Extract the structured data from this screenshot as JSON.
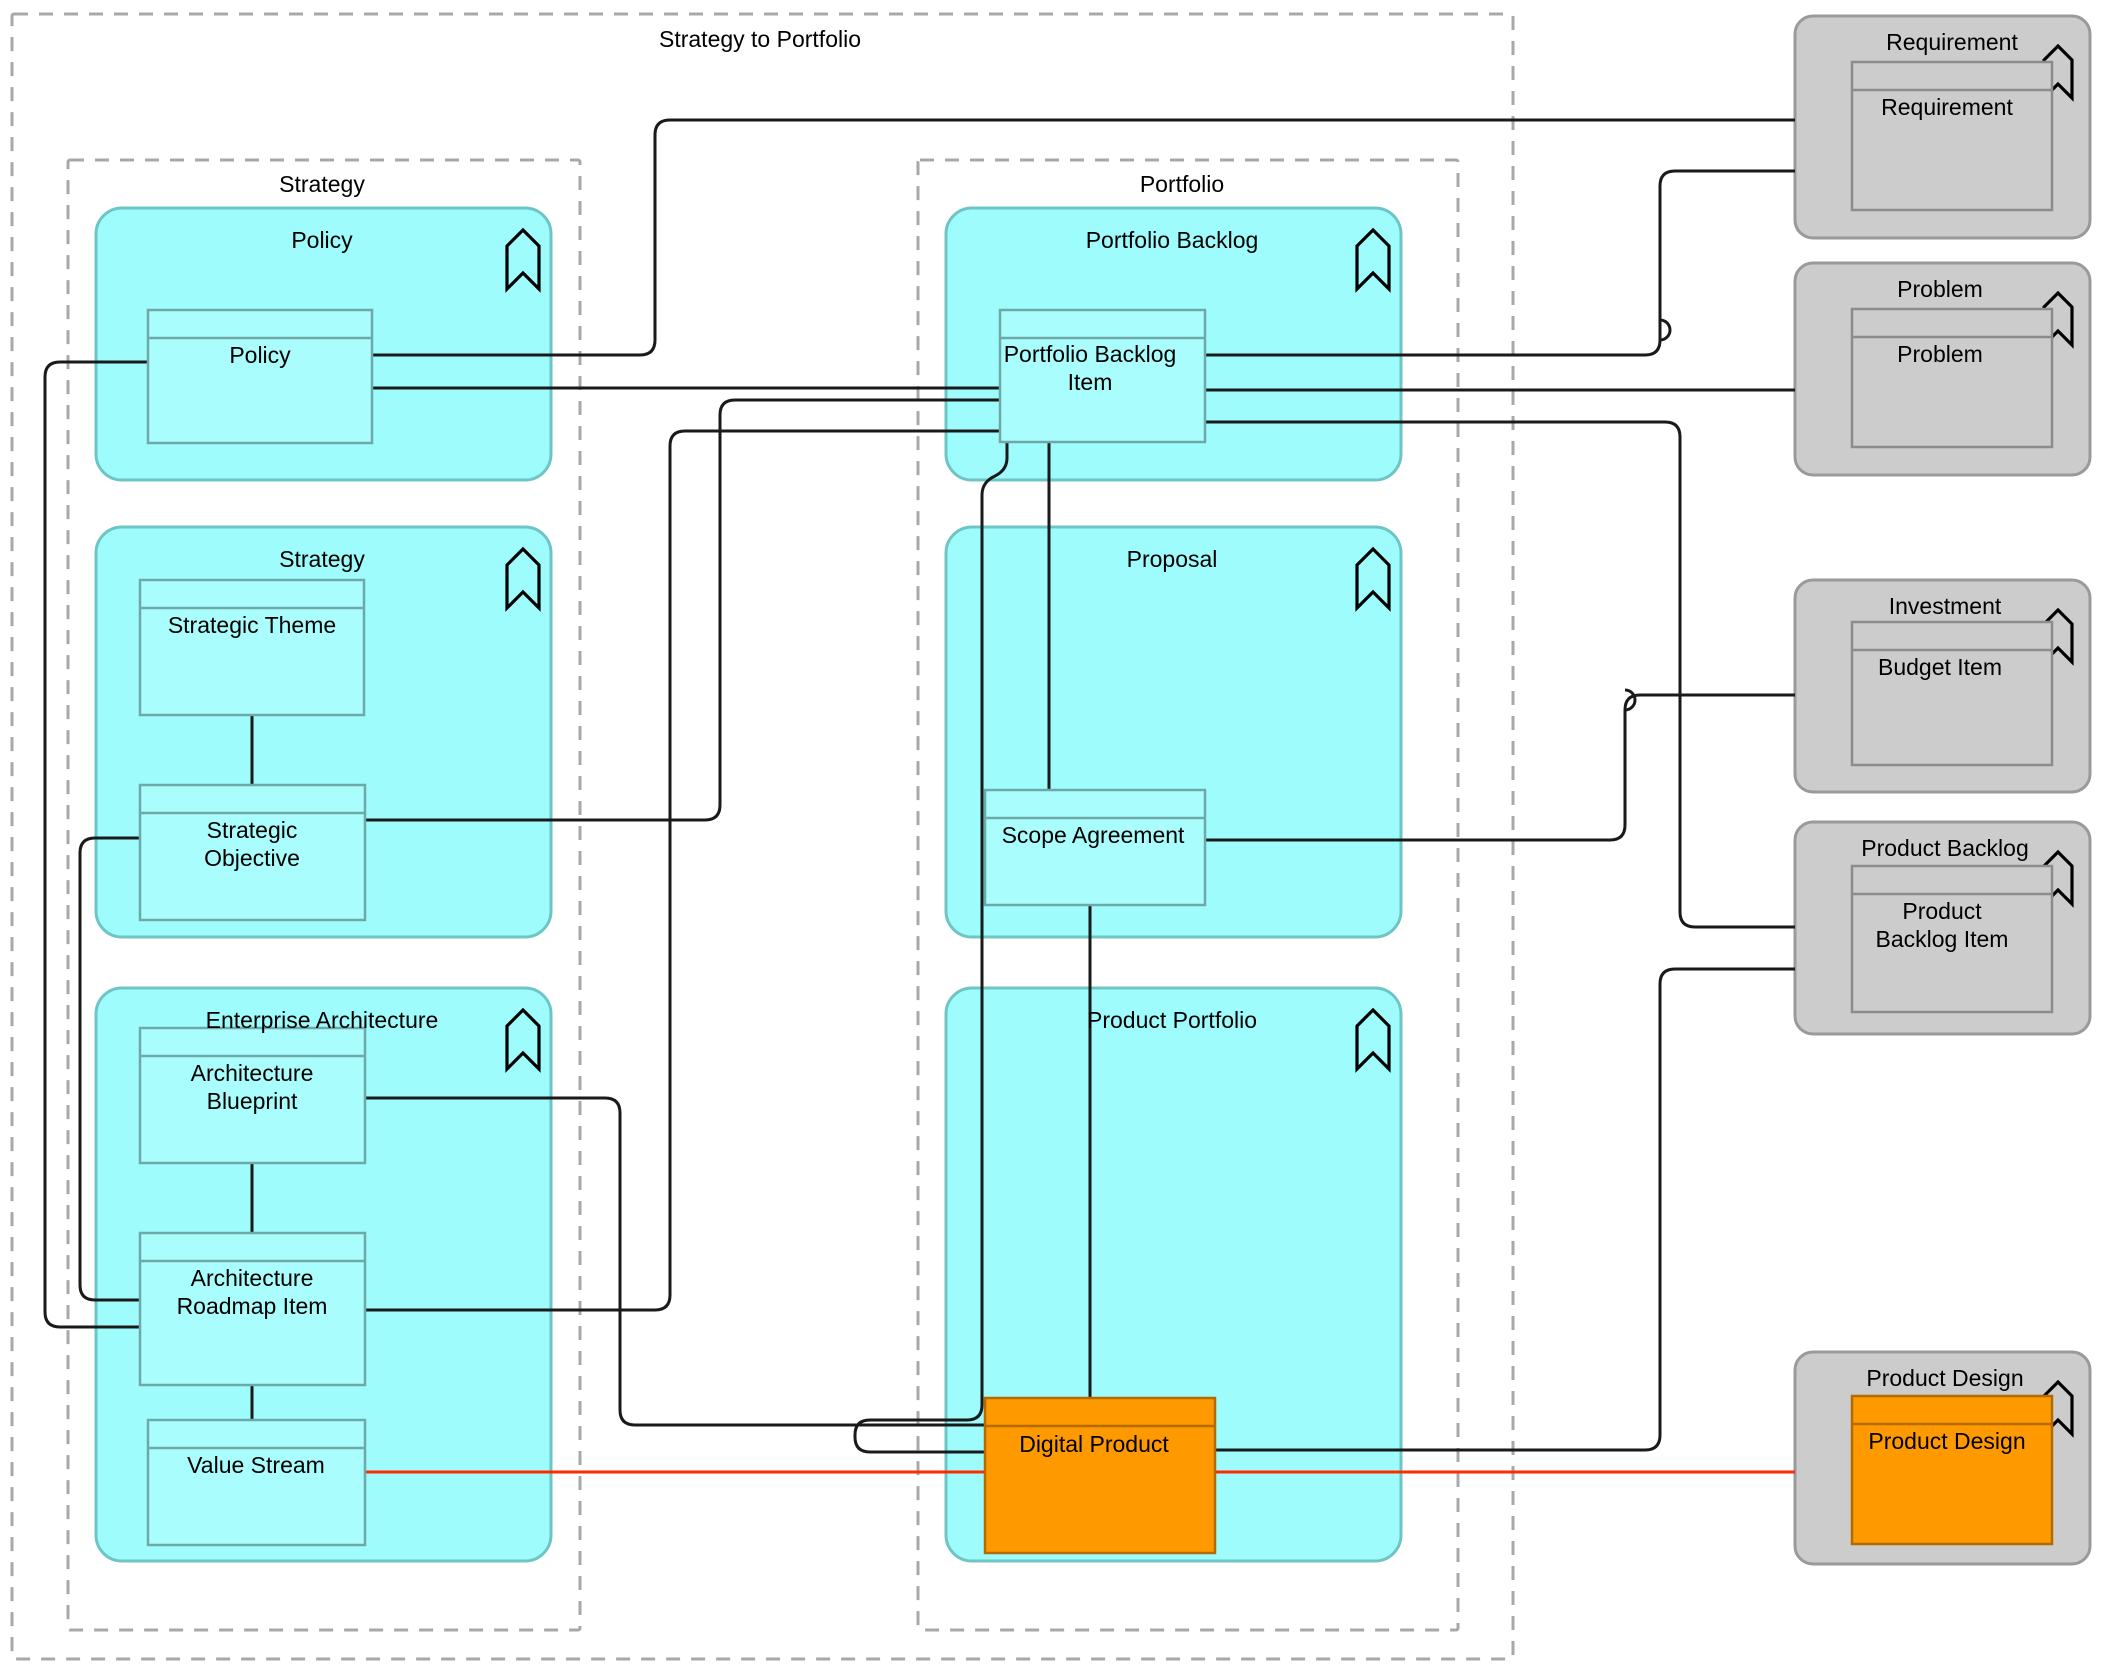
{
  "diagram": {
    "title": "Strategy to Portfolio",
    "colors": {
      "group_cyan_fill": "#9ffcfc",
      "group_cyan_stroke": "#6fc4c4",
      "inner_cyan_fill": "#aafdfd",
      "inner_cyan_stroke": "#6fa8a8",
      "group_gray_fill": "#cccccc",
      "group_gray_stroke": "#9a9a9a",
      "inner_gray_fill": "#cccccc",
      "inner_gray_stroke": "#8c8c8c",
      "orange_fill": "#ff9900",
      "orange_stroke": "#b36b00",
      "connector_black": "#1a1a1a",
      "connector_red": "#ff2a00",
      "dashed_border": "#a8a8a8",
      "background": "#ffffff"
    },
    "icon": "chevron-up-outline-icon"
  },
  "containers": {
    "outer": {
      "label": "Strategy to Portfolio"
    },
    "strategy_lane": {
      "label": "Strategy"
    },
    "portfolio_lane": {
      "label": "Portfolio"
    }
  },
  "groups": [
    {
      "id": "policy",
      "label": "Policy",
      "color": "cyan",
      "icon": "chevron-up-outline-icon",
      "elements": [
        {
          "label": "Policy"
        }
      ]
    },
    {
      "id": "strategy",
      "label": "Strategy",
      "color": "cyan",
      "icon": "chevron-up-outline-icon",
      "elements": [
        {
          "label": "Strategic Theme"
        },
        {
          "label": "Strategic Objective"
        }
      ]
    },
    {
      "id": "enterprise_arch",
      "label": "Enterprise Architecture",
      "color": "cyan",
      "icon": "chevron-up-outline-icon",
      "elements": [
        {
          "label": "Architecture Blueprint"
        },
        {
          "label": "Architecture Roadmap Item"
        },
        {
          "label": "Value Stream"
        }
      ]
    },
    {
      "id": "portfolio_backlog",
      "label": "Portfolio Backlog",
      "color": "cyan",
      "icon": "chevron-up-outline-icon",
      "elements": [
        {
          "label": "Portfolio Backlog Item"
        }
      ]
    },
    {
      "id": "proposal",
      "label": "Proposal",
      "color": "cyan",
      "icon": "chevron-up-outline-icon",
      "elements": [
        {
          "label": "Scope Agreement"
        }
      ]
    },
    {
      "id": "product_portfolio",
      "label": "Product Portfolio",
      "color": "cyan",
      "icon": "chevron-up-outline-icon",
      "elements": [
        {
          "label": "Digital Product",
          "fill": "orange"
        }
      ]
    },
    {
      "id": "requirement",
      "label": "Requirement",
      "color": "gray",
      "icon": "chevron-up-outline-icon",
      "elements": [
        {
          "label": "Requirement"
        }
      ]
    },
    {
      "id": "problem",
      "label": "Problem",
      "color": "gray",
      "icon": "chevron-up-outline-icon",
      "elements": [
        {
          "label": "Problem"
        }
      ]
    },
    {
      "id": "investment",
      "label": "Investment",
      "color": "gray",
      "icon": "chevron-up-outline-icon",
      "elements": [
        {
          "label": "Budget Item"
        }
      ]
    },
    {
      "id": "product_backlog",
      "label": "Product Backlog",
      "color": "gray",
      "icon": "chevron-up-outline-icon",
      "elements": [
        {
          "label": "Product Backlog Item"
        }
      ]
    },
    {
      "id": "product_design",
      "label": "Product Design",
      "color": "gray",
      "icon": "chevron-up-outline-icon",
      "elements": [
        {
          "label": "Product Design",
          "fill": "orange"
        }
      ]
    }
  ],
  "element_labels": {
    "policy": "Policy",
    "strategic_theme": "Strategic Theme",
    "strategic_objective_l1": "Strategic",
    "strategic_objective_l2": "Objective",
    "architecture_blueprint_l1": "Architecture",
    "architecture_blueprint_l2": "Blueprint",
    "architecture_roadmap_l1": "Architecture",
    "architecture_roadmap_l2": "Roadmap Item",
    "value_stream": "Value Stream",
    "portfolio_backlog_item_l1": "Portfolio Backlog",
    "portfolio_backlog_item_l2": "Item",
    "scope_agreement": "Scope Agreement",
    "digital_product": "Digital Product",
    "requirement": "Requirement",
    "problem": "Problem",
    "budget_item": "Budget Item",
    "product_backlog_item_l1": "Product",
    "product_backlog_item_l2": "Backlog Item",
    "product_design": "Product Design"
  },
  "group_labels": {
    "policy": "Policy",
    "strategy": "Strategy",
    "enterprise_architecture": "Enterprise Architecture",
    "portfolio_backlog": "Portfolio Backlog",
    "proposal": "Proposal",
    "product_portfolio": "Product Portfolio",
    "requirement": "Requirement",
    "problem": "Problem",
    "investment": "Investment",
    "product_backlog": "Product Backlog",
    "product_design": "Product Design"
  },
  "relationships": [
    {
      "from": "Policy",
      "to": "Requirement",
      "color": "black"
    },
    {
      "from": "Policy",
      "to": "Portfolio Backlog Item",
      "color": "black"
    },
    {
      "from": "Policy",
      "to": "Architecture Roadmap Item",
      "color": "black"
    },
    {
      "from": "Strategic Theme",
      "to": "Strategic Objective",
      "color": "black"
    },
    {
      "from": "Strategic Objective",
      "to": "Portfolio Backlog Item",
      "color": "black"
    },
    {
      "from": "Strategic Objective",
      "to": "Architecture Roadmap Item",
      "color": "black"
    },
    {
      "from": "Architecture Blueprint",
      "to": "Architecture Roadmap Item",
      "color": "black"
    },
    {
      "from": "Architecture Blueprint",
      "to": "Digital Product",
      "color": "black"
    },
    {
      "from": "Architecture Roadmap Item",
      "to": "Value Stream",
      "color": "black"
    },
    {
      "from": "Architecture Roadmap Item",
      "to": "Portfolio Backlog Item",
      "color": "black"
    },
    {
      "from": "Value Stream",
      "to": "Product Design",
      "color": "red"
    },
    {
      "from": "Portfolio Backlog Item",
      "to": "Requirement",
      "color": "black"
    },
    {
      "from": "Portfolio Backlog Item",
      "to": "Problem",
      "color": "black"
    },
    {
      "from": "Portfolio Backlog Item",
      "to": "Product Backlog Item",
      "color": "black"
    },
    {
      "from": "Portfolio Backlog Item",
      "to": "Scope Agreement",
      "color": "black"
    },
    {
      "from": "Portfolio Backlog Item",
      "to": "Digital Product",
      "color": "black"
    },
    {
      "from": "Scope Agreement",
      "to": "Budget Item",
      "color": "black"
    },
    {
      "from": "Scope Agreement",
      "to": "Digital Product",
      "color": "black"
    },
    {
      "from": "Digital Product",
      "to": "Product Backlog Item",
      "color": "black"
    },
    {
      "from": "Digital Product",
      "to": "Product Design",
      "color": "red"
    }
  ]
}
